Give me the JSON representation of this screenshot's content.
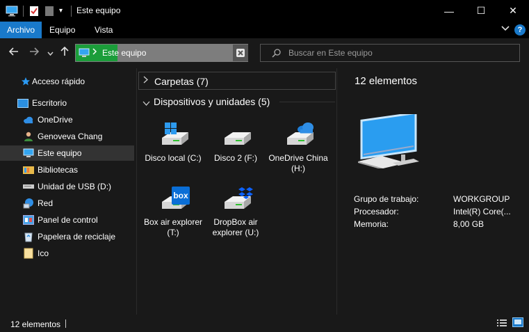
{
  "window": {
    "title": "Este equipo",
    "controls": {
      "minimize": "—",
      "maximize": "☐",
      "close": "✕"
    }
  },
  "ribbon": {
    "tabs": [
      {
        "label": "Archivo",
        "active": true
      },
      {
        "label": "Equipo",
        "active": false
      },
      {
        "label": "Vista",
        "active": false
      }
    ],
    "help": "?"
  },
  "address": {
    "path": "Este equipo",
    "search_placeholder": "Buscar en Este equipo"
  },
  "sidebar": {
    "items": [
      {
        "label": "Acceso rápido",
        "icon": "star-icon"
      },
      {
        "label": "Escritorio",
        "icon": "desktop-icon"
      },
      {
        "label": "OneDrive",
        "icon": "onedrive-cloud-icon"
      },
      {
        "label": "Genoveva Chang",
        "icon": "user-folder-icon"
      },
      {
        "label": "Este equipo",
        "icon": "computer-icon",
        "selected": true
      },
      {
        "label": "Bibliotecas",
        "icon": "libraries-icon"
      },
      {
        "label": "Unidad de USB (D:)",
        "icon": "usb-drive-icon"
      },
      {
        "label": "Red",
        "icon": "network-icon"
      },
      {
        "label": "Panel de control",
        "icon": "control-panel-icon"
      },
      {
        "label": "Papelera de reciclaje",
        "icon": "recycle-bin-icon"
      },
      {
        "label": "Ico",
        "icon": "folder-icon"
      }
    ]
  },
  "main": {
    "folders_group": "Carpetas (7)",
    "devices_group": "Dispositivos y unidades (5)",
    "drives": [
      {
        "label": "Disco local (C:)",
        "badge": "windows-logo-icon"
      },
      {
        "label": "Disco 2 (F:)",
        "badge": ""
      },
      {
        "label": "OneDrive China (H:)",
        "badge": "onedrive-cloud-icon"
      },
      {
        "label": "Box air explorer (T:)",
        "badge": "box-logo-icon",
        "badge_text": "box"
      },
      {
        "label": "DropBox air explorer (U:)",
        "badge": "dropbox-logo-icon"
      }
    ]
  },
  "details": {
    "title": "12 elementos",
    "properties": [
      {
        "label": "Grupo de trabajo:",
        "value": "WORKGROUP"
      },
      {
        "label": "Procesador:",
        "value": "Intel(R) Core(..."
      },
      {
        "label": "Memoria:",
        "value": "8,00 GB"
      }
    ]
  },
  "status": {
    "count": "12 elementos"
  },
  "colors": {
    "accent": "#1979ca",
    "background": "#191919",
    "titlebar": "#000000",
    "address_highlight": "#1b9d3a"
  }
}
